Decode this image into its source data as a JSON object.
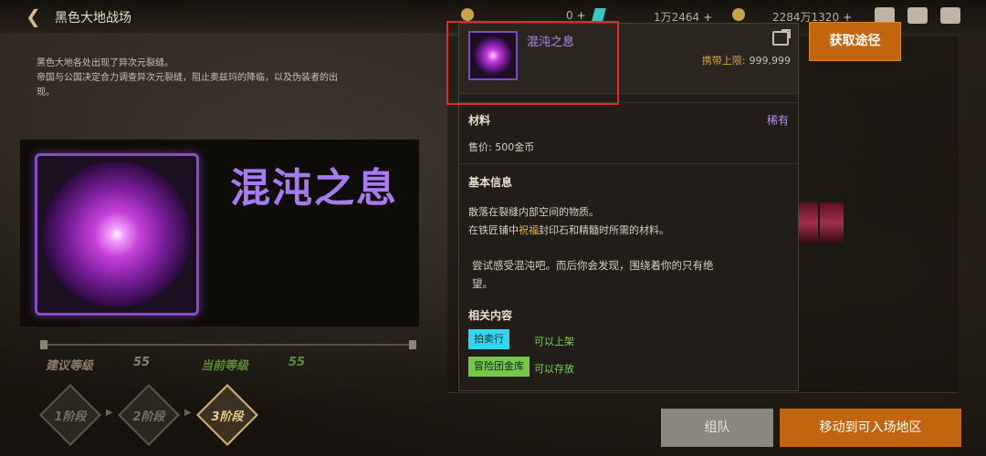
{
  "header": {
    "title": "黑色大地战场",
    "currency_1": {
      "value": "0",
      "plus": "+"
    },
    "currency_2": {
      "value": "1万2464",
      "plus": "+"
    },
    "currency_3": {
      "value": "2284万1320",
      "plus": "+"
    }
  },
  "description": {
    "line1": "黑色大地各处出现了异次元裂缝。",
    "line2": "帝国与公国决定合力调查异次元裂缝，阻止奥兹玛的降临，以及伪装者的出",
    "line3": "现。"
  },
  "item_showcase": {
    "name": "混沌之息"
  },
  "levels": {
    "recommended_label": "建议等级",
    "recommended_value": "55",
    "current_label": "当前等级",
    "current_value": "55"
  },
  "stages": [
    {
      "label": "1阶段"
    },
    {
      "label": "2阶段"
    },
    {
      "label": "3阶段"
    }
  ],
  "tooltip": {
    "name": "混沌之息",
    "carry_limit_label": "携带上限:",
    "carry_limit_value": "999,999",
    "category": "材料",
    "rarity": "稀有",
    "price": "售价: 500金币",
    "basic_info_title": "基本信息",
    "info_line1": "散落在裂缝内部空间的物质。",
    "info_line2_pre": "在铁匠铺中",
    "info_line2_hl": "祝福",
    "info_line2_post": "封印石和精髓时所需的材料。",
    "quote_line1": "尝试感受混沌吧。而后你会发现，围绕着你的只有绝",
    "quote_line2": "望。",
    "related_title": "相关内容",
    "tag1": "拍卖行",
    "tag1_note": "可以上架",
    "tag2": "冒险团金库",
    "tag2_note": "可以存放"
  },
  "buttons": {
    "get_route": "获取途径",
    "team": "组队",
    "move": "移动到可入场地区"
  },
  "colors": {
    "accent_orange": "#c2650f",
    "rare_purple": "#b58cf2",
    "highlight_gold": "#e7b73c",
    "tag_cyan": "#33d6f0",
    "tag_green": "#76c84a"
  }
}
